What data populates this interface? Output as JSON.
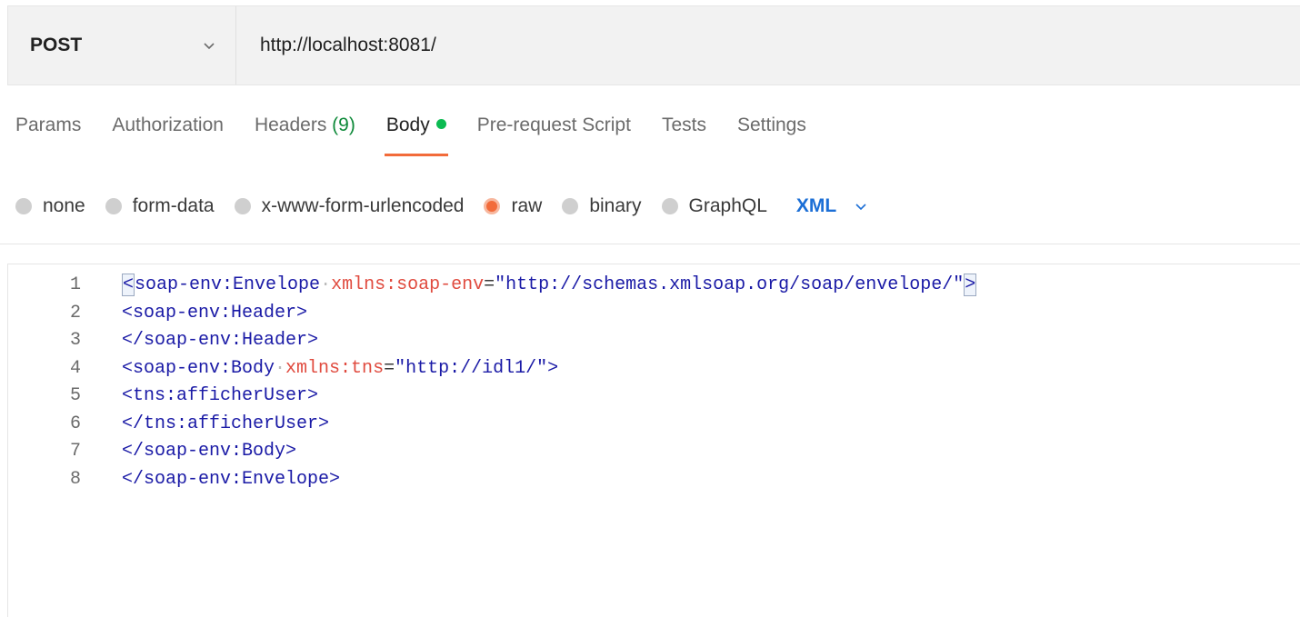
{
  "request": {
    "method": "POST",
    "url": "http://localhost:8081/"
  },
  "tabs": [
    {
      "label": "Params"
    },
    {
      "label": "Authorization"
    },
    {
      "label": "Headers",
      "count": "(9)"
    },
    {
      "label": "Body",
      "active": true
    },
    {
      "label": "Pre-request Script"
    },
    {
      "label": "Tests"
    },
    {
      "label": "Settings"
    }
  ],
  "body_types": [
    {
      "label": "none"
    },
    {
      "label": "form-data"
    },
    {
      "label": "x-www-form-urlencoded"
    },
    {
      "label": "raw",
      "selected": true
    },
    {
      "label": "binary"
    },
    {
      "label": "GraphQL"
    }
  ],
  "format": "XML",
  "editor": {
    "lines": [
      {
        "number": "1",
        "tokens": [
          {
            "t": "tag",
            "text": "<soap-env:Envelope"
          },
          {
            "t": "ws",
            "text": "·"
          },
          {
            "t": "attr",
            "text": "xmlns:soap-env"
          },
          {
            "t": "eq",
            "text": "="
          },
          {
            "t": "val",
            "text": "\"http://schemas.xmlsoap.org/soap/envelope/\""
          },
          {
            "t": "tag",
            "text": ">"
          }
        ]
      },
      {
        "number": "2",
        "tokens": [
          {
            "t": "tag",
            "text": "<soap-env:Header>"
          }
        ]
      },
      {
        "number": "3",
        "tokens": [
          {
            "t": "tag",
            "text": "</soap-env:Header>"
          }
        ]
      },
      {
        "number": "4",
        "tokens": [
          {
            "t": "tag",
            "text": "<soap-env:Body"
          },
          {
            "t": "ws",
            "text": "·"
          },
          {
            "t": "attr",
            "text": "xmlns:tns"
          },
          {
            "t": "eq",
            "text": "="
          },
          {
            "t": "val",
            "text": "\"http://idl1/\""
          },
          {
            "t": "tag",
            "text": ">"
          }
        ]
      },
      {
        "number": "5",
        "tokens": [
          {
            "t": "tag",
            "text": "<tns:afficherUser>"
          }
        ]
      },
      {
        "number": "6",
        "tokens": [
          {
            "t": "tag",
            "text": "</tns:afficherUser>"
          }
        ]
      },
      {
        "number": "7",
        "tokens": [
          {
            "t": "tag",
            "text": "</soap-env:Body>"
          }
        ]
      },
      {
        "number": "8",
        "tokens": [
          {
            "t": "tag",
            "text": "</soap-env:Envelope>"
          }
        ]
      }
    ]
  },
  "colors": {
    "accent": "#f26b3a",
    "tag": "#1a1aa6",
    "attribute": "#e04b3f",
    "format": "#1c6fd6",
    "body_dot": "#0cbb52"
  }
}
